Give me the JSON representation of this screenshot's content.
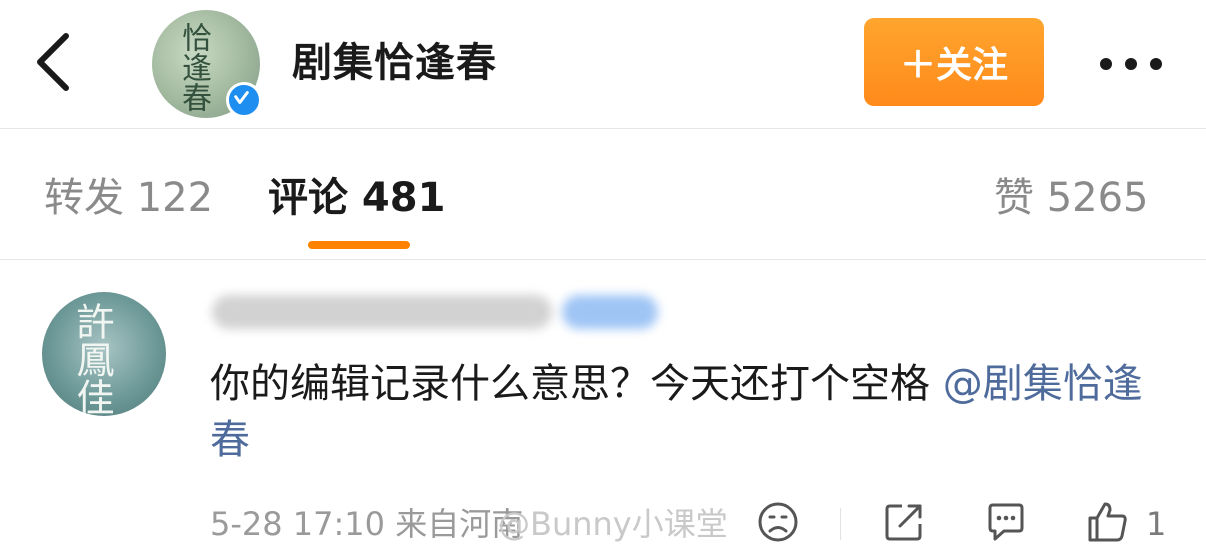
{
  "header": {
    "account_name": "剧集恰逢春",
    "avatar_text": "恰逢春",
    "follow_label": "＋关注"
  },
  "tabs": {
    "repost": "转发 122",
    "comment": "评论 481",
    "like": "赞 5265"
  },
  "comment": {
    "avatar_text": "許鳳佳",
    "text": "你的编辑记录什么意思？今天还打个空格",
    "mention": "@剧集恰逢春",
    "meta": "5-28 17:10 来自河南",
    "watermark": "@Bunny小课堂",
    "like_count": "1"
  },
  "colors": {
    "accent": "#ff8200",
    "mention": "#4e6b9c",
    "verify": "#1f8ef1"
  }
}
